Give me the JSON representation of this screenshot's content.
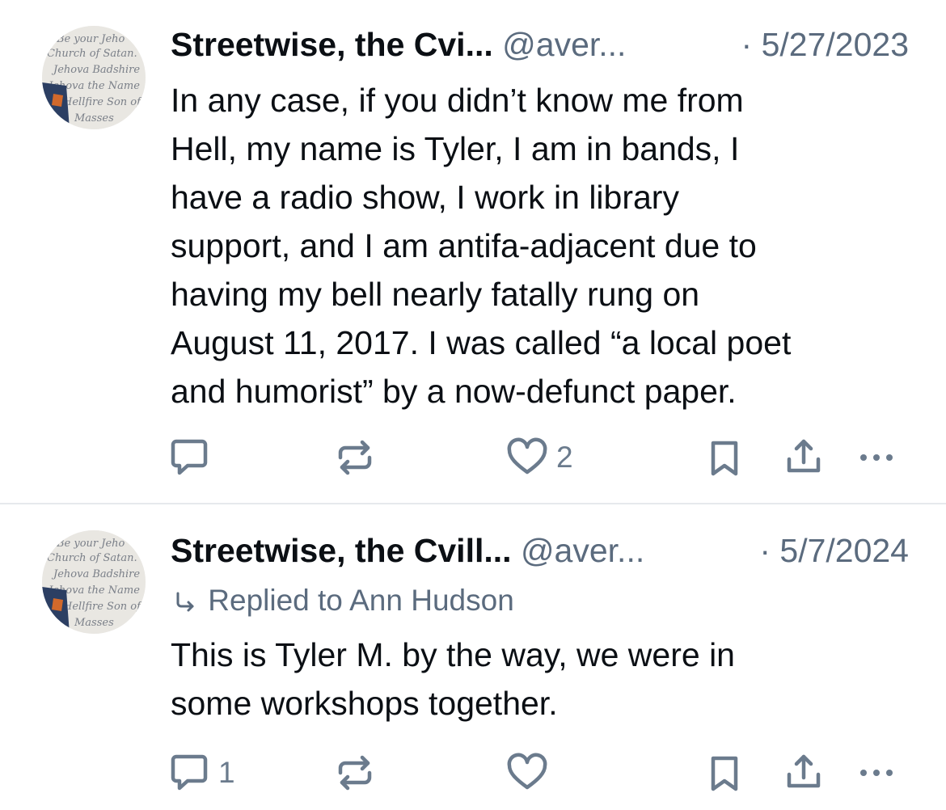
{
  "posts": [
    {
      "author": "Streetwise, the Cvi...",
      "handle": "@aver...",
      "separator": "·",
      "date": "5/27/2023",
      "reply_context": "",
      "text": "In any case, if you didn’t know me from\nHell, my name is Tyler, I am in bands, I\nhave a radio show, I work in library\nsupport, and I am antifa-adjacent due to\nhaving my bell nearly fatally rung on\nAugust 11, 2017. I was called “a local poet\nand humorist” by a now-defunct paper.",
      "reply_count": "",
      "like_count": "2"
    },
    {
      "author": "Streetwise, the Cvill...",
      "handle": "@aver...",
      "separator": "·",
      "date": "5/7/2024",
      "reply_context": "Replied to Ann Hudson",
      "text": "This is Tyler M. by the way, we were in\nsome workshops together.",
      "reply_count": "1",
      "like_count": ""
    }
  ],
  "avatar_text": [
    "Be your Jeho",
    "Church of Satan. To",
    "Jehova Badshire",
    "Jehova the Name",
    "Hellfire Son of",
    "Masses"
  ],
  "icons": {
    "reply": "speech-bubble-icon",
    "repost": "repost-arrows-icon",
    "like": "heart-icon",
    "bookmark": "bookmark-icon",
    "share": "share-upload-icon",
    "more": "more-dots-icon",
    "reply_arrow": "reply-arrow-icon"
  },
  "colors": {
    "text": "#0b0f14",
    "muted": "#5b6b7e",
    "icon": "#6b7b8d",
    "divider": "#e6e9ed"
  }
}
